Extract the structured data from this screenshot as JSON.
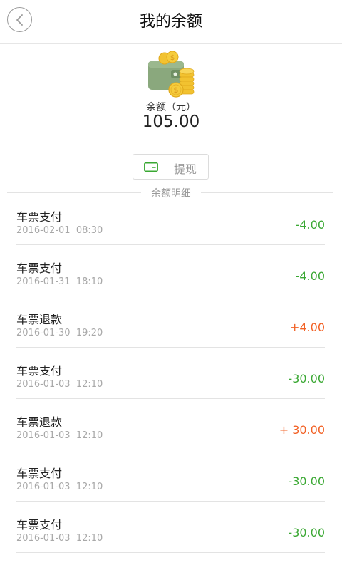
{
  "header": {
    "title": "我的余额",
    "back_icon": "chevron-left-icon"
  },
  "balance": {
    "label": "余额（元）",
    "amount": "105.00",
    "icon": "wallet-with-coins-icon"
  },
  "withdraw": {
    "label": "提现",
    "icon": "wallet-card-icon"
  },
  "section": {
    "title": "余额明细"
  },
  "colors": {
    "negative": "#3aa833",
    "positive": "#f26125",
    "accent_green": "#3aa833"
  },
  "transactions": [
    {
      "title": "车票支付",
      "time": "2016-02-01  08:30",
      "amount": "-4.00",
      "type": "negative"
    },
    {
      "title": "车票支付",
      "time": "2016-01-31  18:10",
      "amount": "-4.00",
      "type": "negative"
    },
    {
      "title": "车票退款",
      "time": "2016-01-30  19:20",
      "amount": "+4.00",
      "type": "positive"
    },
    {
      "title": "车票支付",
      "time": "2016-01-03  12:10",
      "amount": "-30.00",
      "type": "negative"
    },
    {
      "title": "车票退款",
      "time": "2016-01-03  12:10",
      "amount": "+ 30.00",
      "type": "positive"
    },
    {
      "title": "车票支付",
      "time": "2016-01-03  12:10",
      "amount": "-30.00",
      "type": "negative"
    },
    {
      "title": "车票支付",
      "time": "2016-01-03  12:10",
      "amount": "-30.00",
      "type": "negative"
    }
  ]
}
